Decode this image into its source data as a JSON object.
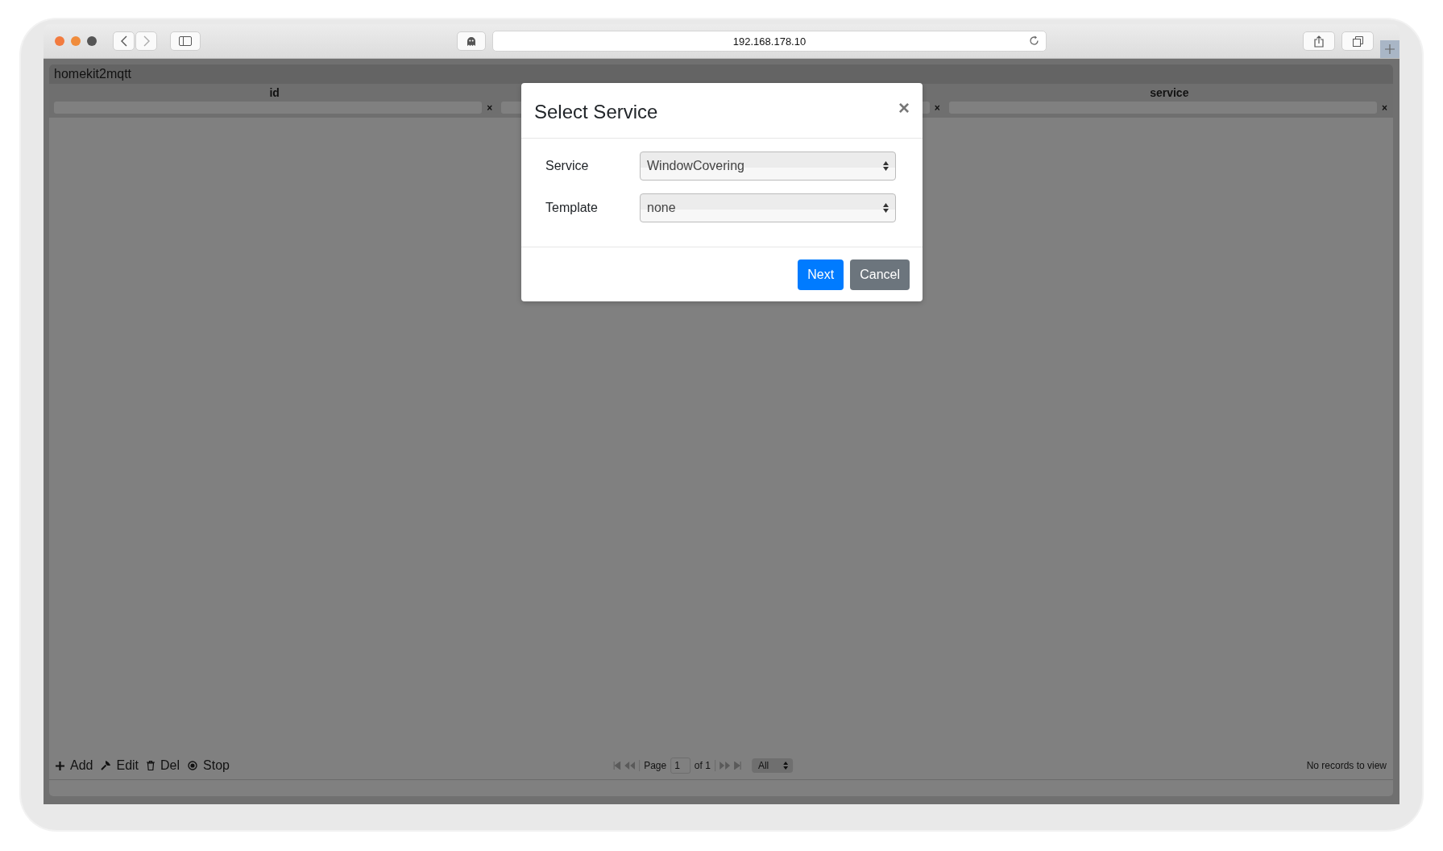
{
  "browser": {
    "url": "192.168.178.10"
  },
  "app": {
    "title": "homekit2mqtt",
    "columns": [
      {
        "kind": "header",
        "header": "id",
        "clear": "×"
      },
      {
        "kind": "covered",
        "clear": "×"
      },
      {
        "kind": "header",
        "header": "service",
        "clear": "×"
      }
    ],
    "toolbar": [
      {
        "label": "Add"
      },
      {
        "label": "Edit"
      },
      {
        "label": "Del"
      },
      {
        "label": "Stop"
      }
    ],
    "pager": {
      "page_label": "Page",
      "page": "1",
      "of": "of 1",
      "rows": "All"
    },
    "status": "No records to view"
  },
  "dialog": {
    "title": "Select Service",
    "close": "×",
    "fields": [
      {
        "label": "Service",
        "value": "WindowCovering"
      },
      {
        "label": "Template",
        "value": "none"
      }
    ],
    "buttons": [
      {
        "kind": "primary",
        "label": "Next"
      },
      {
        "kind": "secondary",
        "label": "Cancel"
      }
    ]
  }
}
